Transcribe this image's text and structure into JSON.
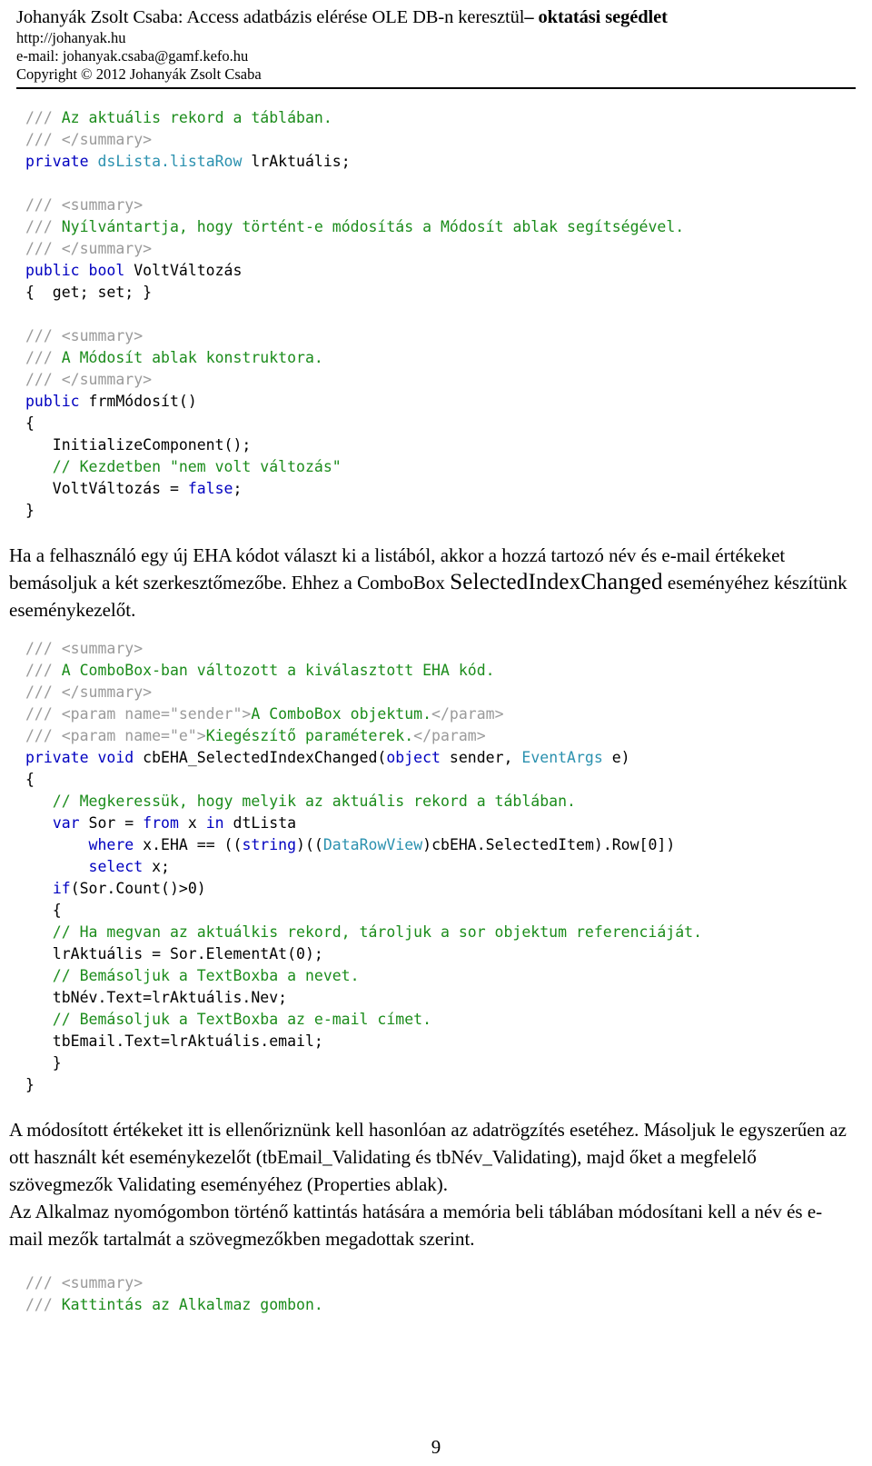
{
  "header": {
    "title_plain": "Johanyák Zsolt Csaba: Access adatbázis elérése OLE DB-n keresztül",
    "title_bold": "– oktatási segédlet",
    "url": "http://johanyak.hu",
    "email": "e-mail: johanyak.csaba@gamf.kefo.hu",
    "copyright": "Copyright © 2012 Johanyák Zsolt Csaba"
  },
  "code_block_1": {
    "lines": [
      [
        {
          "t": "/// ",
          "c": "xd"
        },
        {
          "t": "Az aktuális rekord a táblában.",
          "c": "cm"
        }
      ],
      [
        {
          "t": "/// </summary>",
          "c": "xd"
        }
      ],
      [
        {
          "t": "private ",
          "c": "k"
        },
        {
          "t": "dsLista.listaRow",
          "c": "ty"
        },
        {
          "t": " lrAktuális;",
          "c": "pl"
        }
      ],
      [],
      [
        {
          "t": "/// <summary>",
          "c": "xd"
        }
      ],
      [
        {
          "t": "/// ",
          "c": "xd"
        },
        {
          "t": "Nyílvántartja, hogy történt-e módosítás a Módosít ablak segítségével.",
          "c": "cm"
        }
      ],
      [
        {
          "t": "/// </summary>",
          "c": "xd"
        }
      ],
      [
        {
          "t": "public bool",
          "c": "k"
        },
        {
          "t": " VoltVáltozás",
          "c": "pl"
        }
      ],
      [
        {
          "t": "{  get; set; }",
          "c": "pl"
        }
      ],
      [],
      [
        {
          "t": "/// <summary>",
          "c": "xd"
        }
      ],
      [
        {
          "t": "/// ",
          "c": "xd"
        },
        {
          "t": "A Módosít ablak konstruktora.",
          "c": "cm"
        }
      ],
      [
        {
          "t": "/// </summary>",
          "c": "xd"
        }
      ],
      [
        {
          "t": "public ",
          "c": "k"
        },
        {
          "t": "frmMódosít()",
          "c": "pl"
        }
      ],
      [
        {
          "t": "{",
          "c": "pl"
        }
      ],
      [
        {
          "t": "   InitializeComponent();",
          "c": "pl"
        }
      ],
      [
        {
          "t": "   // Kezdetben \"nem volt változás\"",
          "c": "cm"
        }
      ],
      [
        {
          "t": "   VoltVáltozás = ",
          "c": "pl"
        },
        {
          "t": "false",
          "c": "k"
        },
        {
          "t": ";",
          "c": "pl"
        }
      ],
      [
        {
          "t": "}",
          "c": "pl"
        }
      ]
    ]
  },
  "paragraph_1": {
    "part_a": "Ha a felhasználó egy új EHA kódot választ ki a listából, akkor a hozzá tartozó név és e-mail értékeket bemásoljuk a két szerkesztőmezőbe. Ehhez a ComboBox ",
    "part_big": "SelectedIndexChanged",
    "part_b": " eseményéhez készítünk eseménykezelőt."
  },
  "code_block_2": {
    "lines": [
      [
        {
          "t": "/// <summary>",
          "c": "xd"
        }
      ],
      [
        {
          "t": "/// ",
          "c": "xd"
        },
        {
          "t": "A ComboBox-ban változott a kiválasztott EHA kód.",
          "c": "cm"
        }
      ],
      [
        {
          "t": "/// </summary>",
          "c": "xd"
        }
      ],
      [
        {
          "t": "/// <param name=\"sender\">",
          "c": "xd"
        },
        {
          "t": "A ComboBox objektum.",
          "c": "cm"
        },
        {
          "t": "</param>",
          "c": "xd"
        }
      ],
      [
        {
          "t": "/// <param name=\"e\">",
          "c": "xd"
        },
        {
          "t": "Kiegészítő paraméterek.",
          "c": "cm"
        },
        {
          "t": "</param>",
          "c": "xd"
        }
      ],
      [
        {
          "t": "private void",
          "c": "k"
        },
        {
          "t": " cbEHA_SelectedIndexChanged(",
          "c": "pl"
        },
        {
          "t": "object",
          "c": "k"
        },
        {
          "t": " sender, ",
          "c": "pl"
        },
        {
          "t": "EventArgs",
          "c": "ty"
        },
        {
          "t": " e)",
          "c": "pl"
        }
      ],
      [
        {
          "t": "{",
          "c": "pl"
        }
      ],
      [
        {
          "t": "   // Megkeressük, hogy melyik az aktuális rekord a táblában.",
          "c": "cm"
        }
      ],
      [
        {
          "t": "   ",
          "c": "pl"
        },
        {
          "t": "var",
          "c": "k"
        },
        {
          "t": " Sor = ",
          "c": "pl"
        },
        {
          "t": "from",
          "c": "k"
        },
        {
          "t": " x ",
          "c": "pl"
        },
        {
          "t": "in",
          "c": "k"
        },
        {
          "t": " dtLista",
          "c": "pl"
        }
      ],
      [
        {
          "t": "       ",
          "c": "pl"
        },
        {
          "t": "where",
          "c": "k"
        },
        {
          "t": " x.EHA == ((",
          "c": "pl"
        },
        {
          "t": "string",
          "c": "k"
        },
        {
          "t": ")((",
          "c": "pl"
        },
        {
          "t": "DataRowView",
          "c": "ty"
        },
        {
          "t": ")cbEHA.SelectedItem).Row[0])",
          "c": "pl"
        }
      ],
      [
        {
          "t": "       ",
          "c": "pl"
        },
        {
          "t": "select",
          "c": "k"
        },
        {
          "t": " x;",
          "c": "pl"
        }
      ],
      [
        {
          "t": "   ",
          "c": "pl"
        },
        {
          "t": "if",
          "c": "k"
        },
        {
          "t": "(Sor.Count()>0)",
          "c": "pl"
        }
      ],
      [
        {
          "t": "   {",
          "c": "pl"
        }
      ],
      [
        {
          "t": "   // Ha megvan az aktuálkis rekord, tároljuk a sor objektum referenciáját.",
          "c": "cm"
        }
      ],
      [
        {
          "t": "   lrAktuális = Sor.ElementAt(0);",
          "c": "pl"
        }
      ],
      [
        {
          "t": "   // Bemásoljuk a TextBoxba a nevet.",
          "c": "cm"
        }
      ],
      [
        {
          "t": "   tbNév.Text=lrAktuális.Nev;",
          "c": "pl"
        }
      ],
      [
        {
          "t": "   // Bemásoljuk a TextBoxba az e-mail címet.",
          "c": "cm"
        }
      ],
      [
        {
          "t": "   tbEmail.Text=lrAktuális.email;",
          "c": "pl"
        }
      ],
      [
        {
          "t": "   }",
          "c": "pl"
        }
      ],
      [
        {
          "t": "}",
          "c": "pl"
        }
      ]
    ]
  },
  "paragraph_2": {
    "text": "A módosított értékeket itt is ellenőriznünk kell hasonlóan az adatrögzítés esetéhez. Másoljuk le egyszerűen az ott használt két eseménykezelőt (tbEmail_Validating és tbNév_Validating), majd őket a megfelelő szövegmezők Validating eseményéhez (Properties ablak)."
  },
  "paragraph_3": {
    "text": "Az Alkalmaz nyomógombon történő kattintás hatására a memória beli táblában módosítani kell a név és e-mail mezők tartalmát a szövegmezőkben megadottak szerint."
  },
  "code_block_3": {
    "lines": [
      [
        {
          "t": "/// <summary>",
          "c": "xd"
        }
      ],
      [
        {
          "t": "/// ",
          "c": "xd"
        },
        {
          "t": "Kattintás az Alkalmaz gombon.",
          "c": "cm"
        }
      ]
    ]
  },
  "footer": {
    "page_number": "9"
  },
  "colors": {
    "keyword": "#0000C0",
    "type": "#2B91AF",
    "comment": "#1B8C1B",
    "xmldoc": "#9A9A9A",
    "text": "#000000",
    "background": "#FFFFFF"
  }
}
